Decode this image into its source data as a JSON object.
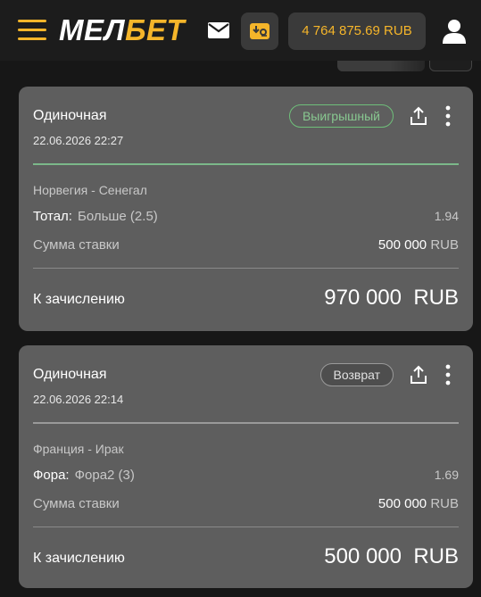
{
  "header": {
    "logo_part1": "МЕЛ",
    "logo_part2": "БЕТ",
    "balance": "4 764 875.69 RUB",
    "icons": [
      "menu-icon",
      "mail-icon",
      "deposit-icon",
      "user-icon"
    ],
    "accent_color": "#f5b52a"
  },
  "bets": [
    {
      "type": "Одиночная",
      "date": "22.06.2026 22:27",
      "status": "Выигрышный",
      "status_color": "#6fbf7a",
      "match": "Норвегия - Сенегал",
      "market": "Тотал:",
      "selection": "Больше (2.5)",
      "odds": "1.94",
      "stake_label": "Сумма ставки",
      "stake_value": "500 000",
      "stake_currency": "RUB",
      "payout_label": "К зачислению",
      "payout": "970 000  RUB"
    },
    {
      "type": "Одиночная",
      "date": "22.06.2026 22:14",
      "status": "Возврат",
      "status_color": "#9a9a9a",
      "match": "Франция - Ирак",
      "market": "Фора:",
      "selection": "Фора2 (3)",
      "odds": "1.69",
      "stake_label": "Сумма ставки",
      "stake_value": "500 000",
      "stake_currency": "RUB",
      "payout_label": "К зачислению",
      "payout": "500 000  RUB"
    }
  ]
}
